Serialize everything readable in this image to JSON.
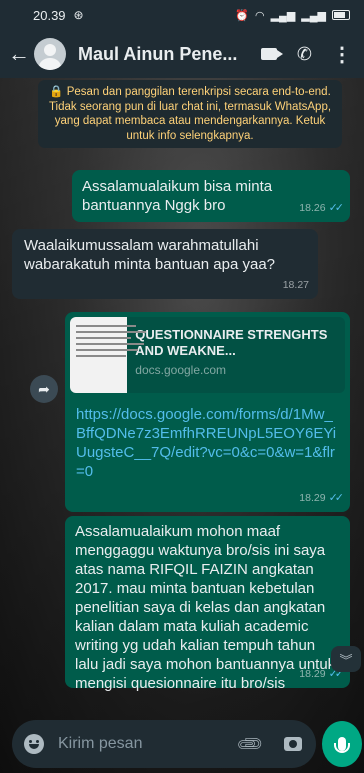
{
  "status_bar": {
    "time": "20.39",
    "left_icon": "whatsapp-status-icon",
    "right_icons": [
      "alarm-icon",
      "wifi-icon",
      "signal-icon",
      "signal-icon",
      "battery-icon"
    ]
  },
  "header": {
    "contact_name": "Maul Ainun Pene...",
    "back_icon": "back-arrow-icon",
    "video_icon": "video-call-icon",
    "call_icon": "phone-icon",
    "more_icon": "more-vert-icon"
  },
  "system_message": {
    "icon": "lock-icon",
    "text": "🔒 Pesan dan panggilan terenkripsi secara end-to-end. Tidak seorang pun di luar chat ini, termasuk WhatsApp, yang dapat membaca atau mendengarkannya. Ketuk untuk info selengkapnya."
  },
  "messages": [
    {
      "direction": "out",
      "text": "Assalamualaikum bisa minta bantuannya Nggk bro",
      "time": "18.26",
      "status": "read"
    },
    {
      "direction": "in",
      "text": "Waalaikumussalam warahmatullahi wabarakatuh minta bantuan apa yaa?",
      "time": "18.27"
    },
    {
      "direction": "out",
      "link_preview": {
        "title": "QUESTIONNAIRE STRENGHTS AND WEAKNE...",
        "domain": "docs.google.com"
      },
      "text": "https://docs.google.com/forms/d/1Mw_BffQDNe7z3EmfhRREUNpL5EOY6EYiUugsteC__7Q/edit?vc=0&c=0&w=1&flr=0",
      "time": "18.29",
      "status": "read"
    },
    {
      "direction": "out",
      "text": "Assalamualaikum mohon maaf menggaggu waktunya bro/sis ini saya atas nama RIFQIL FAIZIN angkatan 2017. mau minta bantuan kebetulan penelitian saya di kelas dan angkatan  kalian dalam mata kuliah academic writing yg udah kalian tempuh tahun lalu jadi saya mohon bantuannya untuk mengisi quesionnaire itu bro/sis",
      "time": "18.29",
      "status": "read"
    }
  ],
  "composer": {
    "placeholder": "Kirim pesan",
    "emoji_icon": "emoji-icon",
    "attach_icon": "attach-icon",
    "camera_icon": "camera-icon",
    "mic_icon": "mic-icon"
  },
  "read_ticks": "✓✓",
  "colors": {
    "header_bg": "#1f2c34",
    "outgoing_bubble": "#005c4b",
    "incoming_bubble": "#202c33",
    "system_text": "#ffd279",
    "accent": "#00a884",
    "link": "#53bdeb"
  }
}
